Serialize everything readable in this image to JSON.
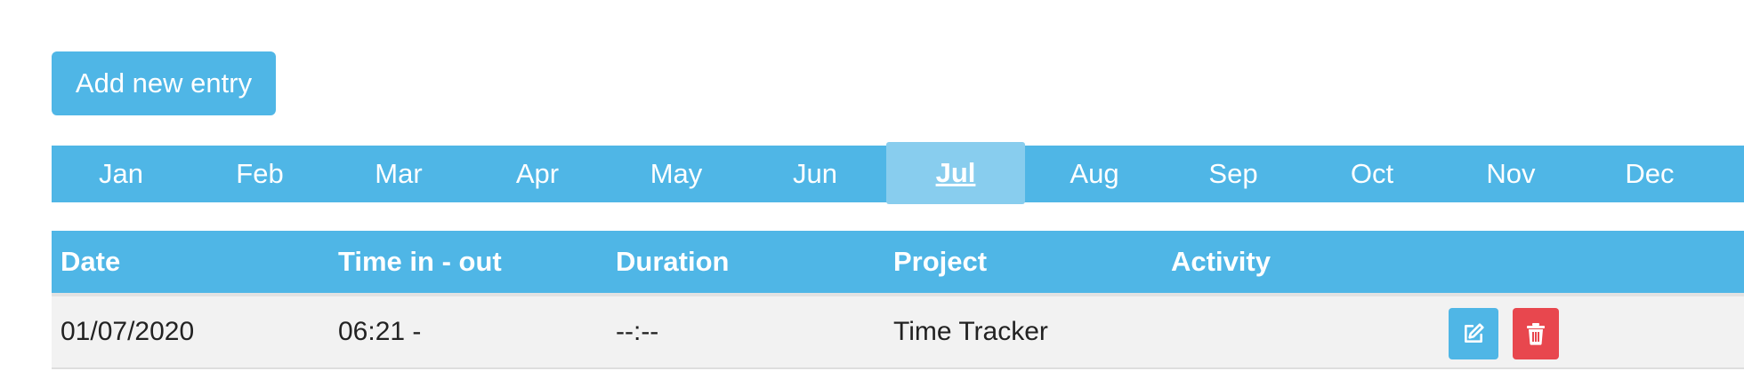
{
  "toolbar": {
    "add_label": "Add new entry"
  },
  "months": [
    "Jan",
    "Feb",
    "Mar",
    "Apr",
    "May",
    "Jun",
    "Jul",
    "Aug",
    "Sep",
    "Oct",
    "Nov",
    "Dec"
  ],
  "active_month": "Jul",
  "table": {
    "headers": [
      "Date",
      "Time in - out",
      "Duration",
      "Project",
      "Activity"
    ],
    "rows": [
      {
        "date": "01/07/2020",
        "time": "06:21 -",
        "duration": "--:--",
        "project": "Time Tracker",
        "activity": ""
      }
    ]
  },
  "row_actions": {
    "edit_icon": "edit-icon",
    "delete_icon": "trash-icon"
  },
  "colors": {
    "accent": "#4fb6e6",
    "active_tab": "#88cdee",
    "danger": "#e8474e",
    "row_bg": "#f2f2f2"
  }
}
